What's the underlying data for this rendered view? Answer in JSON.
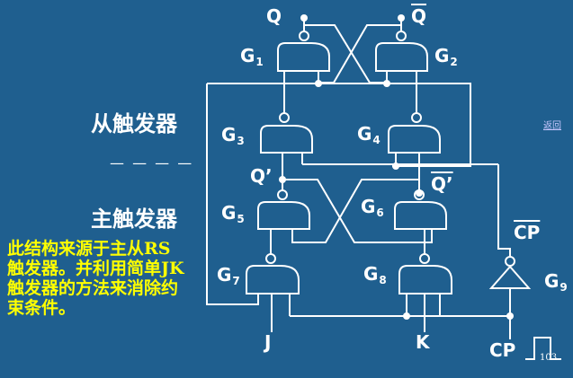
{
  "diagram": {
    "outputs": {
      "q": "Q",
      "q_bar": "Q"
    },
    "inputs": {
      "j": "J",
      "k": "K",
      "cp": "CP",
      "cp_bar": "CP"
    },
    "internal": {
      "q_prime": "Q’",
      "q_prime_bar": "Q’"
    },
    "gates": [
      {
        "letter": "G",
        "index": "1"
      },
      {
        "letter": "G",
        "index": "2"
      },
      {
        "letter": "G",
        "index": "3"
      },
      {
        "letter": "G",
        "index": "4"
      },
      {
        "letter": "G",
        "index": "5"
      },
      {
        "letter": "G",
        "index": "6"
      },
      {
        "letter": "G",
        "index": "7"
      },
      {
        "letter": "G",
        "index": "8"
      },
      {
        "letter": "G",
        "index": "9"
      }
    ],
    "sections": {
      "slave": "从触发器",
      "master": "主触发器"
    },
    "separator": "— —  —    —"
  },
  "note": {
    "line1": "此结构来源于主从",
    "rs": "RS",
    "line2": "触发器。并利用简单",
    "jk": "JK",
    "line3": "触发器的方法来消除约束条件。"
  },
  "nav": {
    "back": "返回"
  },
  "page": {
    "number": "103"
  },
  "colors": {
    "background": "#1f5f8f",
    "lines": "#ffffff",
    "note_text": "#ffff00"
  }
}
